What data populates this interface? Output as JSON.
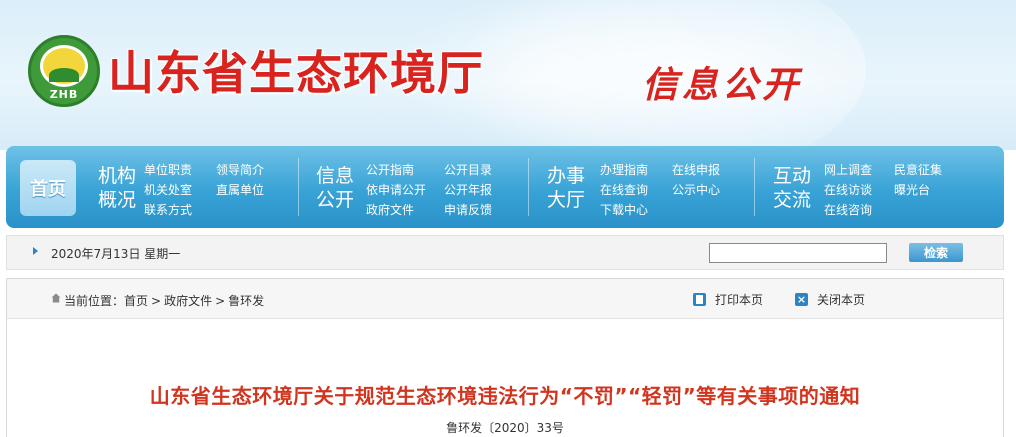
{
  "banner": {
    "logo_text": "ZHB",
    "site_title": "山东省生态环境厅",
    "section_title": "信息公开"
  },
  "nav": {
    "home_label": "首页",
    "groups": [
      {
        "title_line1": "机构",
        "title_line2": "概况",
        "items": [
          "单位职责",
          "领导简介",
          "机关处室",
          "直属单位",
          "联系方式"
        ]
      },
      {
        "title_line1": "信息",
        "title_line2": "公开",
        "items": [
          "公开指南",
          "公开目录",
          "依申请公开",
          "公开年报",
          "政府文件",
          "申请反馈"
        ]
      },
      {
        "title_line1": "办事",
        "title_line2": "大厅",
        "items": [
          "办理指南",
          "在线申报",
          "在线查询",
          "公示中心",
          "下载中心"
        ]
      },
      {
        "title_line1": "互动",
        "title_line2": "交流",
        "items": [
          "网上调查",
          "民意征集",
          "在线访谈",
          "曝光台",
          "在线咨询"
        ]
      }
    ]
  },
  "datebar": {
    "date": "2020年7月13日 星期一",
    "search_placeholder": "",
    "search_button": "检索"
  },
  "breadcrumb": {
    "prefix": "当前位置：",
    "items": [
      "首页",
      "政府文件",
      "鲁环发"
    ],
    "separator": ">"
  },
  "actions": {
    "print_label": "打印本页",
    "close_label": "关闭本页"
  },
  "article": {
    "title": "山东省生态环境厅关于规范生态环境违法行为“不罚”“轻罚”等有关事项的通知",
    "doc_number": "鲁环发〔2020〕33号"
  },
  "colors": {
    "accent_red": "#d8231e",
    "nav_blue": "#38a3d6",
    "headline_red": "#d2341e"
  }
}
